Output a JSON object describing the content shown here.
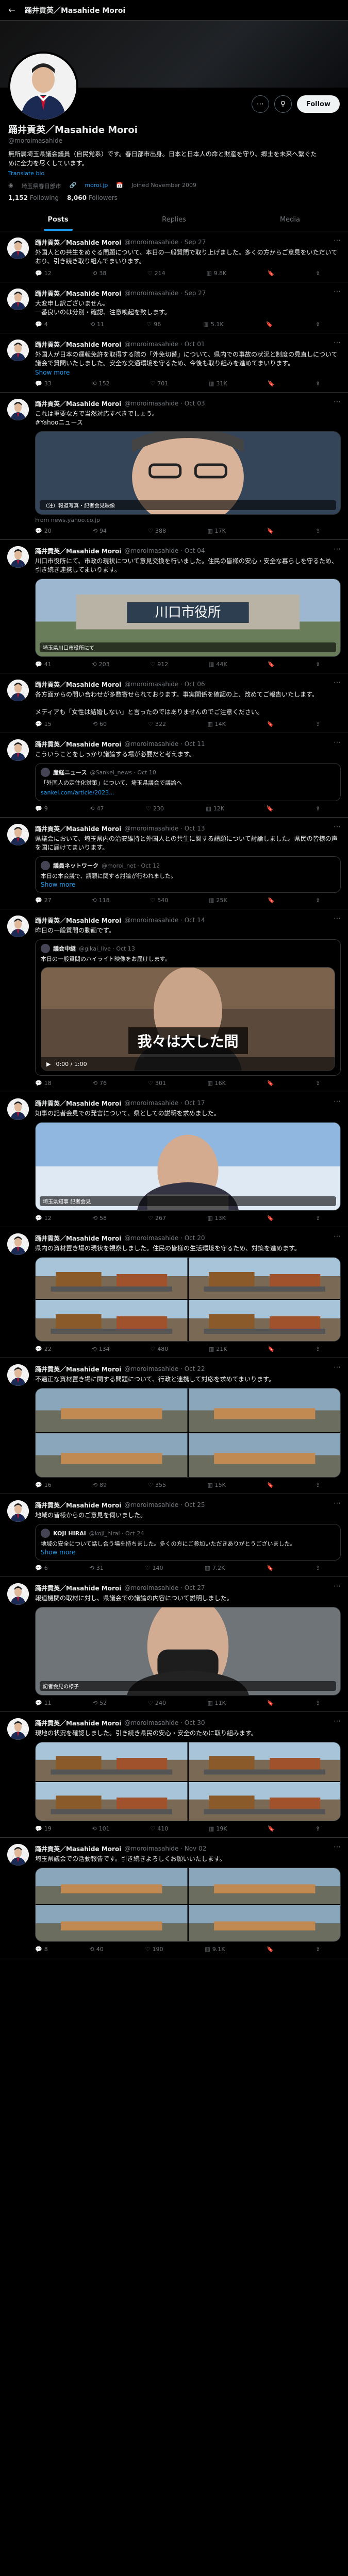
{
  "profile": {
    "top_title": "踊井貢英／Masahide Moroi",
    "name": "踊井貢英／Masahide Moroi",
    "handle": "@moroimasahide",
    "follow_label": "Follow",
    "bio": "無所属埼玉県議会議員（自民党系）です。春日部市出身。日本と日本人の命と財産を守り、郷土を未来へ繋ぐために全力を尽くしています。",
    "translate": "Translate bio",
    "location": "埼玉県春日部市",
    "link": "moroi.jp",
    "joined": "Joined November 2009",
    "following_count": "1,152",
    "following_label": "Following",
    "followers_count": "8,060",
    "followers_label": "Followers"
  },
  "tabs": [
    "Posts",
    "Replies",
    "Media"
  ],
  "tweets": [
    {
      "name": "踊井貢英／Masahide Moroi",
      "meta": "@moroimasahide · Sep 27",
      "text": "外国人との共生をめぐる問題について、本日の一般質問で取り上げました。多くの方からご意見をいただいており、引き続き取り組んでまいります。",
      "stats": [
        "12",
        "38",
        "214",
        "9.8K"
      ]
    },
    {
      "name": "踊井貢英／Masahide Moroi",
      "meta": "@moroimasahide · Sep 27",
      "text": "大変申し訳ございません。\n一番良いのは分別・確認、注意喚起を致します。",
      "stats": [
        "4",
        "11",
        "96",
        "5.1K"
      ]
    },
    {
      "name": "踊井貢英／Masahide Moroi",
      "meta": "@moroimasahide · Oct 01",
      "text": "外国人が日本の運転免許を取得する際の「外免切替」について、県内での事故の状況と制度の見直しについて議会で質問いたしました。安全な交通環境を守るため、今後も取り組みを進めてまいります。",
      "show_more": "Show more",
      "stats": [
        "33",
        "152",
        "701",
        "31K"
      ]
    },
    {
      "name": "踊井貢英／Masahide Moroi",
      "meta": "@moroimasahide · Oct 03",
      "text": "これは重要な方で当然対応すべきでしょう。\n#Yahooニュース",
      "caption": "（注）報道写真・記者会見映像",
      "source": "From news.yahoo.co.jp",
      "stats": [
        "20",
        "94",
        "388",
        "17K"
      ]
    },
    {
      "name": "踊井貢英／Masahide Moroi",
      "meta": "@moroimasahide · Oct 04",
      "text": "川口市役所にて、市政の現状について意見交換を行いました。住民の皆様の安心・安全な暮らしを守るため、引き続き連携してまいります。",
      "caption": "埼玉県川口市役所にて",
      "stats": [
        "41",
        "203",
        "912",
        "44K"
      ]
    },
    {
      "name": "踊井貢英／Masahide Moroi",
      "meta": "@moroimasahide · Oct 06",
      "text": "各方面からの問い合わせが多数寄せられております。事実関係を確認の上、改めてご報告いたします。\n\nメディアも「女性は結婚しない」と言ったのではありませんのでご注意ください。",
      "stats": [
        "15",
        "60",
        "322",
        "14K"
      ]
    },
    {
      "name": "踊井貢英／Masahide Moroi",
      "meta": "@moroimasahide · Oct 11",
      "text": "こういうことをしっかり議論する場が必要だと考えます。",
      "quote_name": "産経ニュース",
      "quote_meta": "@Sankei_news · Oct 10",
      "quote_text": "「外国人の定住化対策」について、埼玉県議会で議論へ",
      "quote_link": "sankei.com/article/2023...",
      "stats": [
        "9",
        "47",
        "230",
        "12K"
      ]
    },
    {
      "name": "踊井貢英／Masahide Moroi",
      "meta": "@moroimasahide · Oct 13",
      "text": "県議会において、埼玉県内の治安維持と外国人との共生に関する請願について討論しました。県民の皆様の声を国に届けてまいります。",
      "quote_name": "議員ネットワーク",
      "quote_meta": "@moroi_net · Oct 12",
      "quote_text": "本日の本会議で、請願に関する討論が行われました。",
      "show_more": "Show more",
      "stats": [
        "27",
        "118",
        "540",
        "25K"
      ]
    },
    {
      "name": "踊井貢英／Masahide Moroi",
      "meta": "@moroimasahide · Oct 14",
      "text": "昨日の一般質問の動画です。",
      "quote_name": "議会中継",
      "quote_meta": "@gikai_live · Oct 13",
      "quote_text": "本日の一般質問のハイライト映像をお届けします。",
      "subtitle": "我々は大した問",
      "video_time": "0:00 / 1:00",
      "stats": [
        "18",
        "76",
        "301",
        "16K"
      ]
    },
    {
      "name": "踊井貢英／Masahide Moroi",
      "meta": "@moroimasahide · Oct 17",
      "text": "知事の記者会見での発言について、県としての説明を求めました。",
      "caption": "埼玉県知事 記者会見",
      "stats": [
        "12",
        "58",
        "267",
        "13K"
      ]
    },
    {
      "name": "踊井貢英／Masahide Moroi",
      "meta": "@moroimasahide · Oct 20",
      "text": "県内の資材置き場の現状を視察しました。住民の皆様の生活環境を守るため、対策を進めます。",
      "stats": [
        "22",
        "134",
        "480",
        "21K"
      ]
    },
    {
      "name": "踊井貢英／Masahide Moroi",
      "meta": "@moroimasahide · Oct 22",
      "text": "不適正な資材置き場に関する問題について、行政と連携して対応を求めてまいります。",
      "stats": [
        "16",
        "89",
        "355",
        "15K"
      ]
    },
    {
      "name": "踊井貢英／Masahide Moroi",
      "meta": "@moroimasahide · Oct 25",
      "text": "地域の皆様からのご意見を伺いました。",
      "quote_name": "KOJI HIRAI",
      "quote_meta": "@koji_hirai · Oct 24",
      "quote_text": "地域の安全について話し合う場を持ちました。多くの方にご参加いただきありがとうございました。",
      "show_more": "Show more",
      "stats": [
        "6",
        "31",
        "140",
        "7.2K"
      ]
    },
    {
      "name": "踊井貢英／Masahide Moroi",
      "meta": "@moroimasahide · Oct 27",
      "text": "報道機関の取材に対し、県議会での議論の内容について説明しました。",
      "caption": "記者会見の様子",
      "stats": [
        "11",
        "52",
        "240",
        "11K"
      ]
    },
    {
      "name": "踊井貢英／Masahide Moroi",
      "meta": "@moroimasahide · Oct 30",
      "text": "現地の状況を確認しました。引き続き県民の安心・安全のために取り組みます。",
      "stats": [
        "19",
        "101",
        "410",
        "19K"
      ]
    },
    {
      "name": "踊井貢英／Masahide Moroi",
      "meta": "@moroimasahide · Nov 02",
      "text": "埼玉県議会での活動報告です。引き続きよろしくお願いいたします。",
      "stats": [
        "8",
        "40",
        "190",
        "9.1K"
      ]
    }
  ]
}
